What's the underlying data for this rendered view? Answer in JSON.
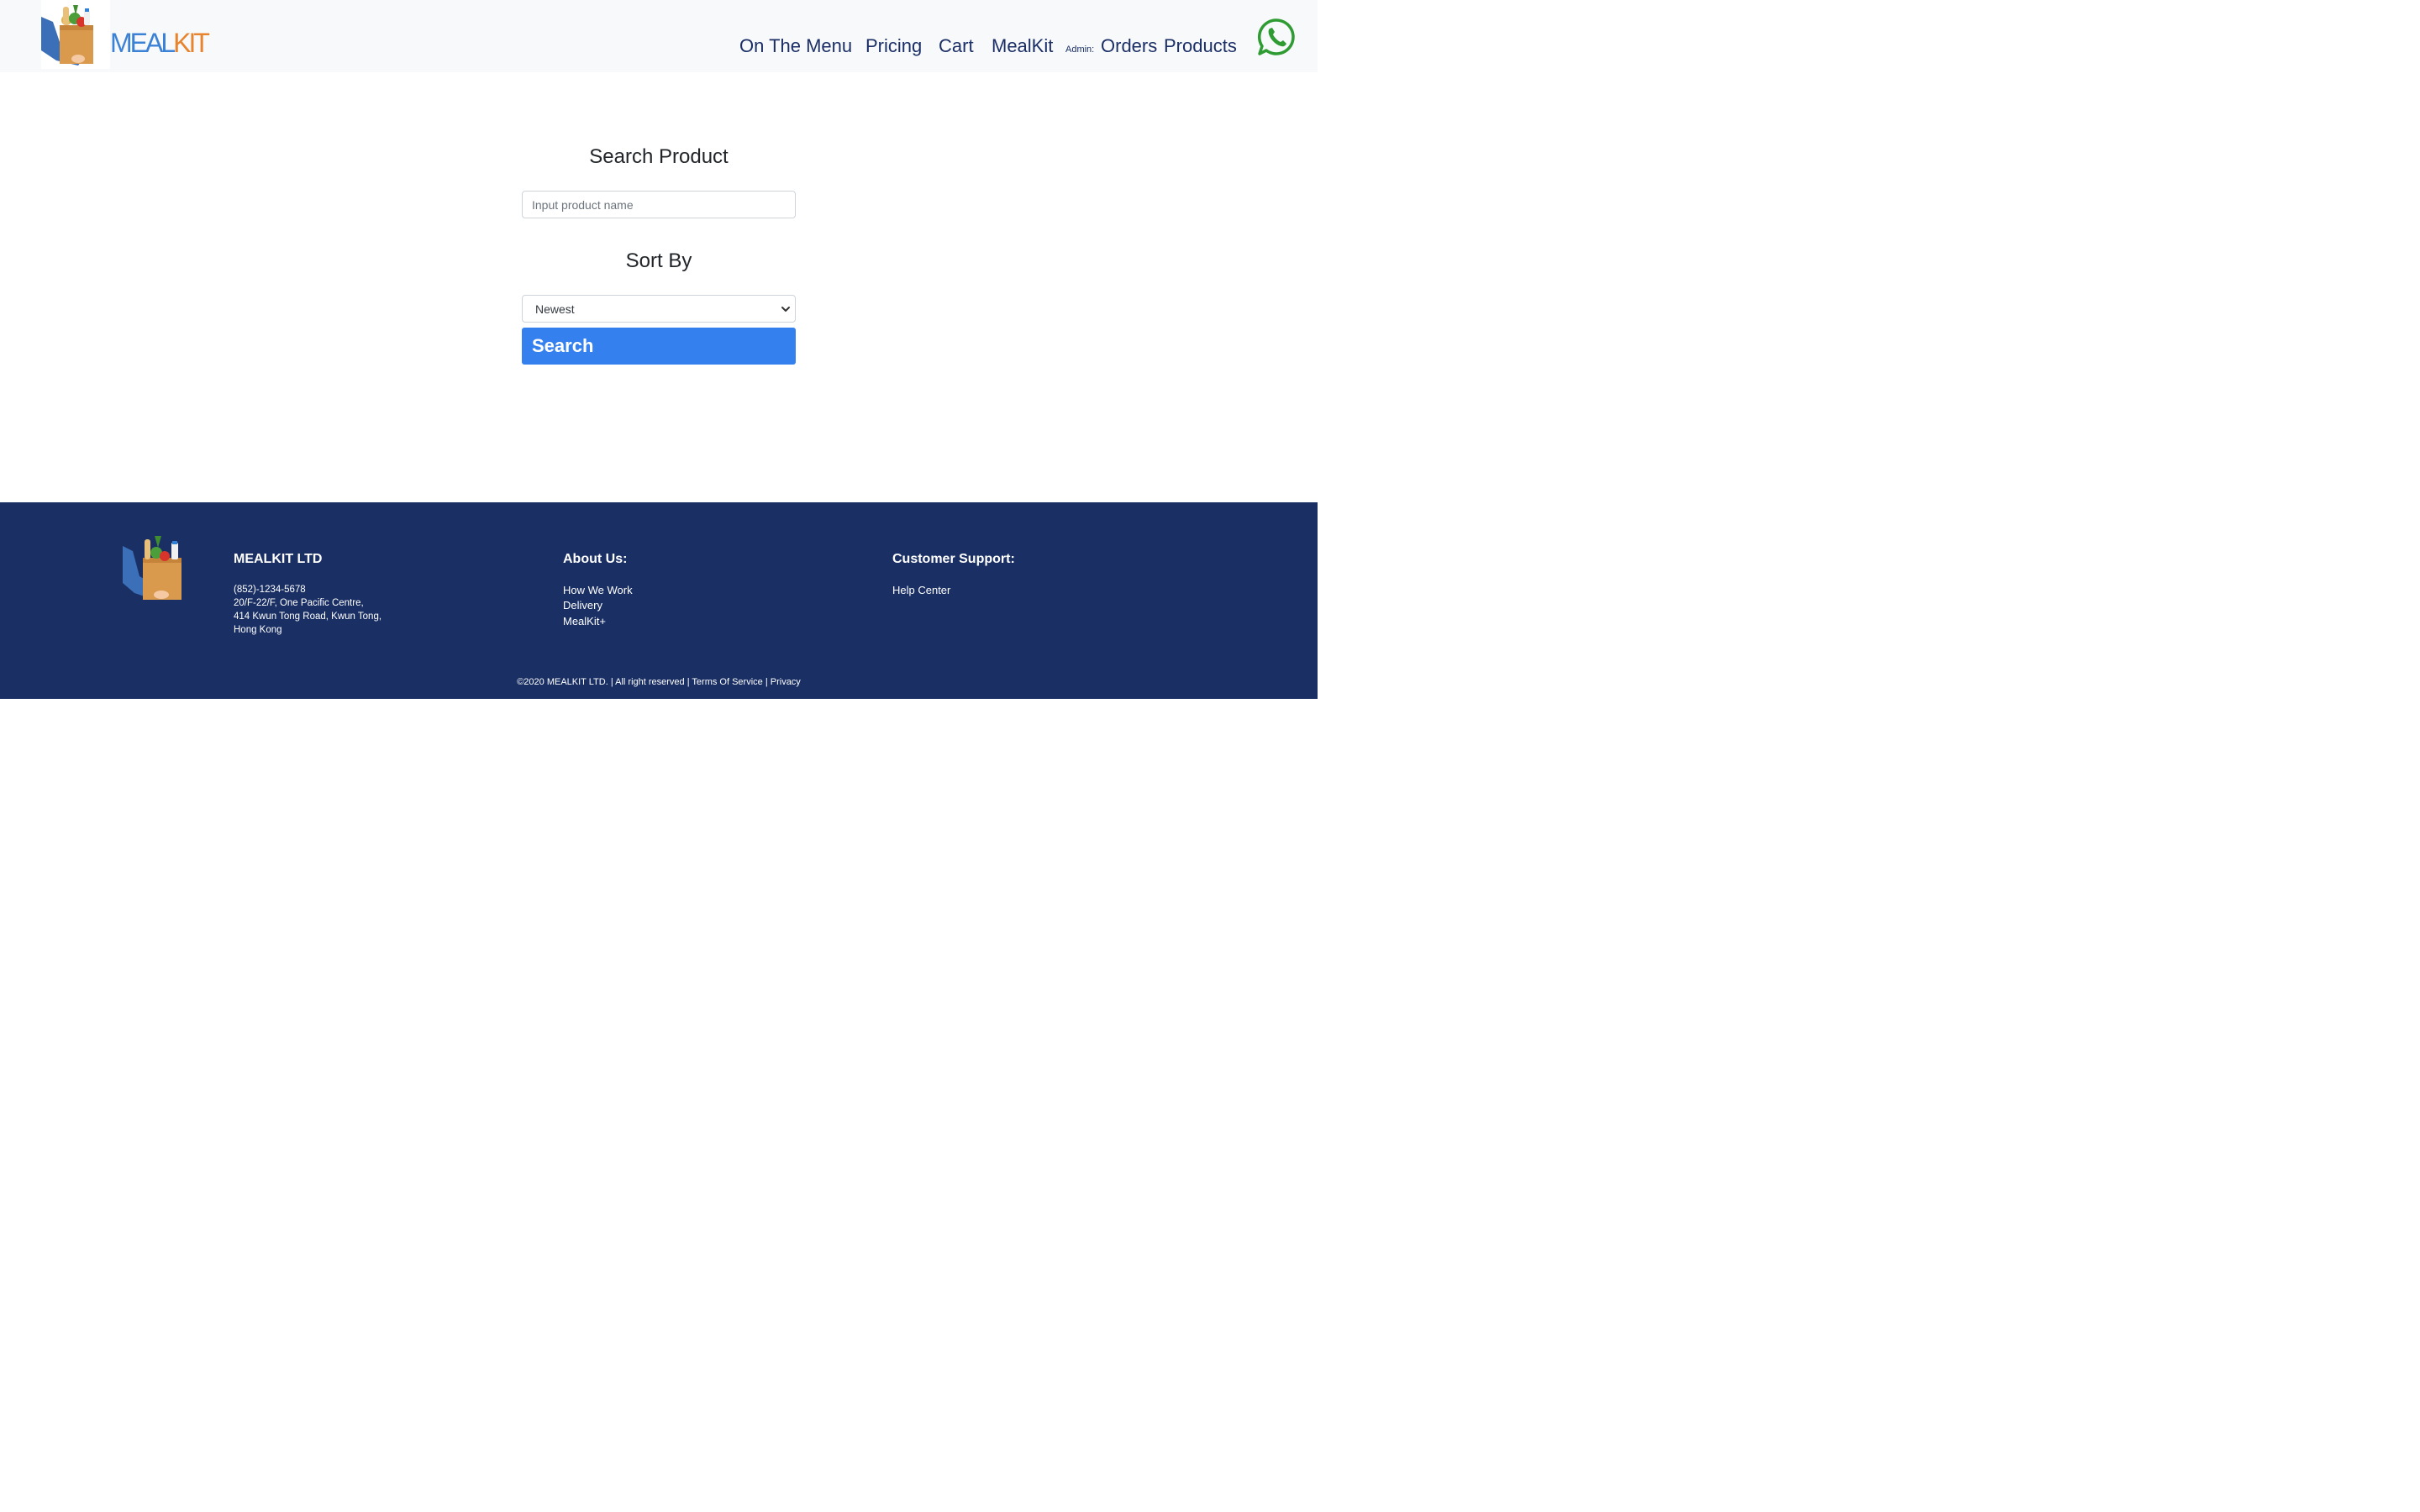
{
  "header": {
    "brand_part1": "MEAL",
    "brand_part2": "KIT",
    "nav": {
      "on_the_menu": "On The Menu",
      "pricing": "Pricing",
      "cart": "Cart",
      "mealkit": "MealKit",
      "admin_label": "Admin:",
      "orders": "Orders",
      "products": "Products"
    },
    "whatsapp_icon": "whatsapp-icon"
  },
  "main": {
    "search_title": "Search Product",
    "search_placeholder": "Input product name",
    "search_value": "",
    "sort_title": "Sort By",
    "sort_selected": "Newest",
    "search_button": "Search"
  },
  "footer": {
    "company": "MEALKIT LTD",
    "phone": "(852)-1234-5678",
    "address_line1": "20/F-22/F, One Pacific Centre,",
    "address_line2": "414 Kwun Tong Road, Kwun Tong,",
    "address_line3": "Hong Kong",
    "about_title": "About Us:",
    "about_links": [
      "How We Work",
      "Delivery",
      "MealKit+"
    ],
    "support_title": "Customer Support:",
    "support_links": [
      "Help Center"
    ],
    "copyright": "©2020 MEALKIT LTD. | All right reserved | Terms Of Service | Privacy"
  },
  "colors": {
    "header_bg": "#f8f9fb",
    "nav_text": "#1b2f66",
    "brand_blue": "#3b82d6",
    "brand_orange": "#e8832e",
    "button_blue": "#3580ef",
    "footer_bg": "#1a2f63",
    "whatsapp_green": "#2e9b33"
  }
}
